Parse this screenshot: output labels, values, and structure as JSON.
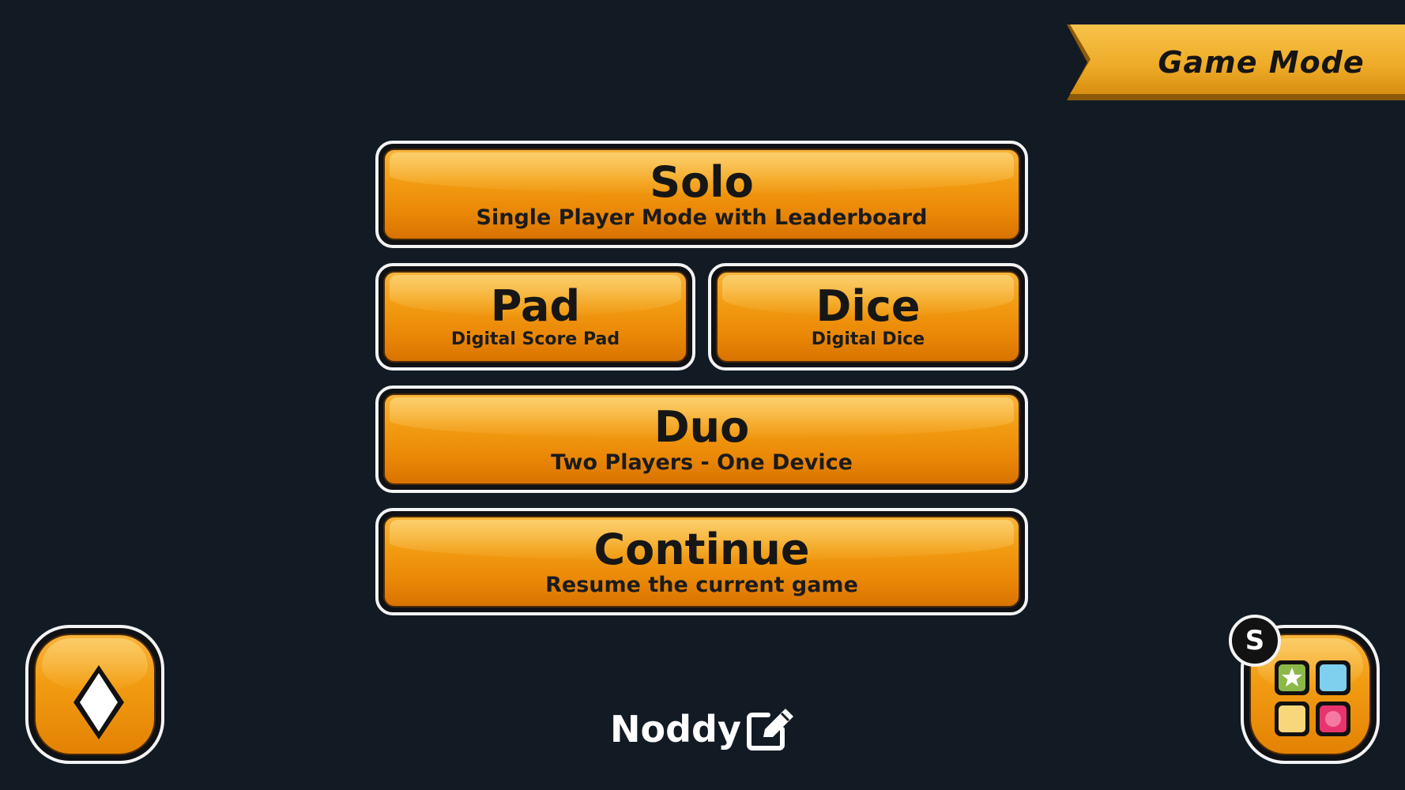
{
  "banner": {
    "title": "Game Mode"
  },
  "modes": {
    "solo": {
      "title": "Solo",
      "subtitle": "Single Player Mode with Leaderboard"
    },
    "pad": {
      "title": "Pad",
      "subtitle": "Digital Score Pad"
    },
    "dice": {
      "title": "Dice",
      "subtitle": "Digital Dice"
    },
    "duo": {
      "title": "Duo",
      "subtitle": "Two Players - One Device"
    },
    "continue": {
      "title": "Continue",
      "subtitle": "Resume the current game"
    }
  },
  "player": {
    "name": "Noddy"
  },
  "apps_badge": {
    "label": "S"
  },
  "icons": {
    "back": "back-arrow-icon",
    "apps": "apps-grid-icon",
    "edit": "edit-pencil-icon"
  },
  "colors": {
    "background": "#121b24",
    "button_orange": "#f29c12",
    "banner_gold": "#f0b12e",
    "tile_green": "#8cb84a",
    "tile_blue": "#7fcfee",
    "tile_yellow": "#f7d77a",
    "tile_pink": "#e8346e"
  }
}
